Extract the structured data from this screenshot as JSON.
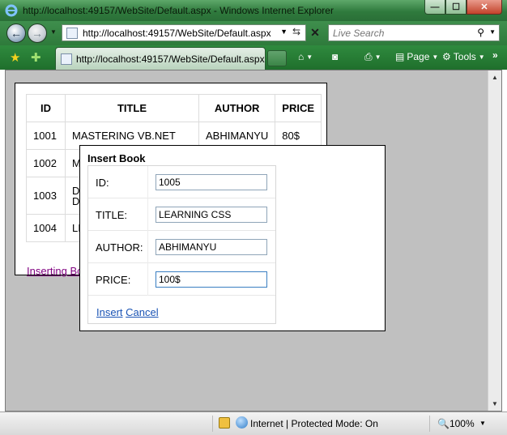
{
  "window": {
    "title": "http://localhost:49157/WebSite/Default.aspx - Windows Internet Explorer",
    "minimize_glyph": "—",
    "maximize_glyph": "☐",
    "close_glyph": "✕"
  },
  "address_bar": {
    "url": "http://localhost:49157/WebSite/Default.aspx"
  },
  "search": {
    "placeholder": "Live Search"
  },
  "tab": {
    "label": "http://localhost:49157/WebSite/Default.aspx"
  },
  "command_bar": {
    "page_label": "Page",
    "tools_label": "Tools"
  },
  "grid": {
    "headers": [
      "ID",
      "TITLE",
      "AUTHOR",
      "PRICE"
    ],
    "rows": [
      [
        "1001",
        "MASTERING VB.NET",
        "ABHIMANYU",
        "80$"
      ],
      [
        "1002",
        "M",
        "",
        ""
      ],
      [
        "1003",
        "D\nD",
        "",
        ""
      ],
      [
        "1004",
        "LI",
        "",
        ""
      ]
    ],
    "link_label": "Inserting Bo"
  },
  "popup": {
    "title": "Insert Book",
    "fields": {
      "id": {
        "label": "ID:",
        "value": "1005"
      },
      "title": {
        "label": "TITLE:",
        "value": "LEARNING CSS"
      },
      "author": {
        "label": "AUTHOR:",
        "value": "ABHIMANYU"
      },
      "price": {
        "label": "PRICE:",
        "value": "100$"
      }
    },
    "insert_label": "Insert",
    "cancel_label": "Cancel"
  },
  "status_bar": {
    "zone_text": "Internet | Protected Mode: On",
    "zoom": "100%"
  },
  "colors": {
    "frame_green": "#2f7a3d",
    "page_background": "#c0c0c0",
    "link_visited": "#800080",
    "link_blue": "#1b54b5"
  }
}
